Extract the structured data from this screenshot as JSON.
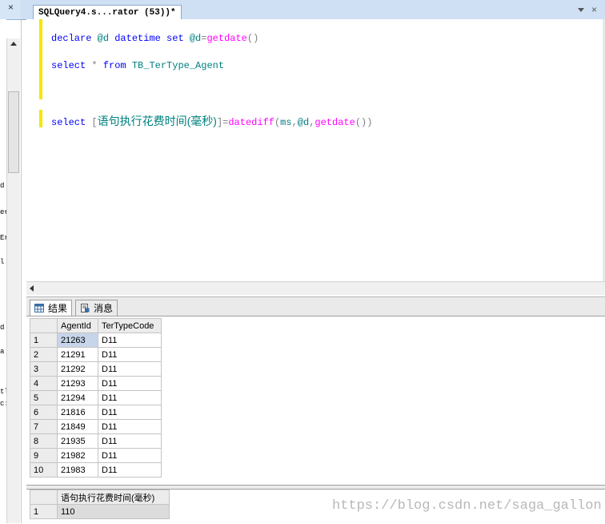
{
  "editor_tab": {
    "title": "SQLQuery4.s...rator (53))*",
    "close": "×"
  },
  "left_panel": {
    "close": "×",
    "fragments": [
      "d",
      "er",
      "Er",
      "l",
      "d",
      "a",
      "tl",
      "c:"
    ]
  },
  "editor": {
    "line1": {
      "declare": "declare",
      "var": "@d",
      "type": "datetime",
      "set": "set",
      "var2": "@d",
      "eq": "=",
      "func": "getdate",
      "parens": "()"
    },
    "line2": {
      "select": "select",
      "star": "*",
      "from": "from",
      "table": "TB_TerType_Agent"
    },
    "line3": {
      "select": "select",
      "lbr": "[",
      "alias": "语句执行花费时间(毫秒)",
      "rbr": "]",
      "eq": "=",
      "func": "datediff",
      "lp": "(",
      "arg1": "ms",
      "c1": ",",
      "arg2": "@d",
      "c2": ",",
      "func2": "getdate",
      "rp": "())"
    }
  },
  "results_tabs": {
    "results_label": "结果",
    "messages_label": "消息"
  },
  "grid1": {
    "columns": [
      "AgentId",
      "TerTypeCode"
    ],
    "rows": [
      {
        "n": "1",
        "agent": "21263",
        "code": "D11"
      },
      {
        "n": "2",
        "agent": "21291",
        "code": "D11"
      },
      {
        "n": "3",
        "agent": "21292",
        "code": "D11"
      },
      {
        "n": "4",
        "agent": "21293",
        "code": "D11"
      },
      {
        "n": "5",
        "agent": "21294",
        "code": "D11"
      },
      {
        "n": "6",
        "agent": "21816",
        "code": "D11"
      },
      {
        "n": "7",
        "agent": "21849",
        "code": "D11"
      },
      {
        "n": "8",
        "agent": "21935",
        "code": "D11"
      },
      {
        "n": "9",
        "agent": "21982",
        "code": "D11"
      },
      {
        "n": "10",
        "agent": "21983",
        "code": "D11"
      }
    ]
  },
  "grid2": {
    "column": "语句执行花费时间(毫秒)",
    "row_num": "1",
    "value": "110"
  },
  "watermark": "https://blog.csdn.net/saga_gallon",
  "colors": {
    "keyword": "#0000ff",
    "function": "#ff00ff",
    "identifier": "#008080",
    "operator": "#808080",
    "change_marker": "#f5e600"
  }
}
